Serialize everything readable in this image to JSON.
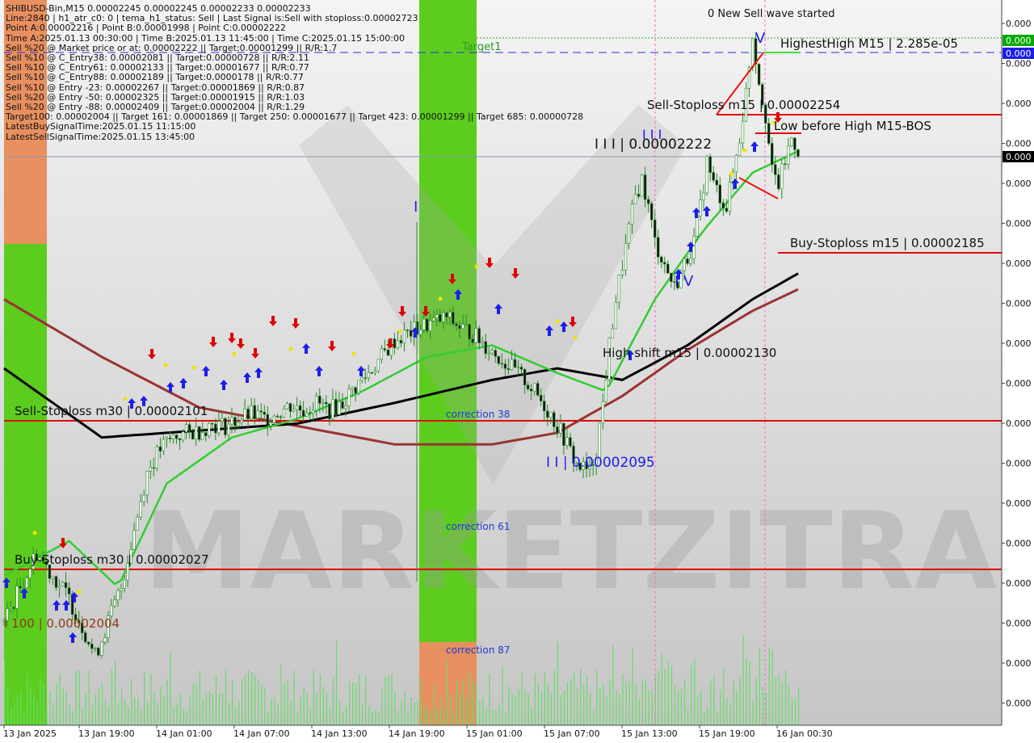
{
  "info_lines": [
    "SHIBUSD-Bin,M15  0.00002245 0.00002245 0.00002233 0.00002233",
    "Line:2840  |  h1_atr_c0: 0  |  tema_h1_status: Sell  |  Last Signal is:Sell with stoploss:0.00002723",
    "Point A:0.00002216  |  Point B:0.00001998  |  Point C:0.00002222",
    "Time A:2025.01.13 00:30:00  |  Time B:2025.01.13 11:45:00  |  Time C:2025.01.15 15:00:00",
    "Sell %20 @ Market price or at: 0.00002222  ||  Target:0.00001299  ||  R/R:1.7",
    "Sell %10 @ C_Entry38: 0.00002081  ||  Target:0.00000728  ||  R/R:2.11",
    "Sell %10 @ C_Entry61: 0.00002133  ||  Target:0.00001677  ||  R/R:0.77",
    "Sell %10 @ C_Entry88: 0.00002189  ||  Target:0.0000178  ||  R/R:0.77",
    "Sell %10 @ Entry -23: 0.00002267  ||  Target:0.00001869  ||  R/R:0.87",
    "Sell %20 @ Entry -50: 0.00002325  ||  Target:0.00001915  ||  R/R:1.03",
    "Sell %20 @ Entry -88: 0.00002409  ||  Target:0.00002004  ||  R/R:1.29",
    "Target100: 0.00002004  ||  Target 161: 0.00001869  ||  Target 250: 0.00001677  ||  Target 423: 0.00001299  ||  Target 685: 0.00000728",
    "LatestBuySignalTime:2025.01.15 11:15:00",
    "LatestSellSignalTime:2025.01.15 13:45:00"
  ],
  "watermark": "MARKETZITRADE",
  "colors": {
    "sell_line": "#e00000",
    "buy_line": "#e00000",
    "ema_green": "#33cc33",
    "ema_black": "#000000",
    "ema_brown": "#993333",
    "candle": "#2a8a2a",
    "volume": "#66dd66",
    "zone_green": "#5ccd1e",
    "zone_orange": "#e89060",
    "price_tag_green": "#00aa00",
    "price_tag_blue": "#1d1de8",
    "price_tag_black": "#000000",
    "wave_blue": "#1d1de8",
    "arrow_up": "#1d1de8",
    "arrow_down": "#e00000"
  },
  "annotations": {
    "new_wave": "0 New Sell wave started",
    "highest_high": "HighestHigh   M15 | 2.285e-05",
    "target1": "Target1",
    "sell_stoploss_m15": "Sell-Stoploss m15 | 0.00002254",
    "low_before_high": "Low before High   M15-BOS",
    "wave_III": "I I I | 0.00002222",
    "buy_stoploss_m15": "Buy-Stoploss m15 | 0.00002185",
    "wave_IV": "I V",
    "wave_V": "V",
    "wave_I": "I",
    "wave_II": "I I | 0.00002095",
    "wave_III_top": "I I I",
    "high_shift": "High shift m15 | 0.00002130",
    "sell_stoploss_m30": "Sell-Stoploss m30 | 0.00002101",
    "buy_stoploss_m30": "Buy-Stoploss m30 | 0.00002027",
    "target_100": "I 100 | 0.00002004",
    "correction_38": "correction 38",
    "correction_61": "correction 61",
    "correction_87": "correction 87"
  },
  "price_tags": [
    "0.000",
    "0.000",
    "0.000"
  ],
  "chart_data": {
    "type": "candlestick",
    "symbol": "SHIBUSD-Bin",
    "timeframe": "M15",
    "ohlc_last": {
      "open": 2.245e-05,
      "high": 2.245e-05,
      "low": 2.233e-05,
      "close": 2.233e-05
    },
    "y_tick_labels": [
      "0.000",
      "0.000",
      "0.000",
      "0.000",
      "0.000",
      "0.000",
      "0.000",
      "0.000",
      "0.000",
      "0.000",
      "0.000",
      "0.000",
      "0.000",
      "0.000",
      "0.000",
      "0.000",
      "0.000",
      "0.000"
    ],
    "x_tick_labels": [
      "13 Jan 2025",
      "13 Jan 19:00",
      "14 Jan 01:00",
      "14 Jan 07:00",
      "14 Jan 13:00",
      "14 Jan 19:00",
      "15 Jan 01:00",
      "15 Jan 07:00",
      "15 Jan 13:00",
      "15 Jan 19:00",
      "16 Jan 00:30"
    ],
    "ylim": [
      1.985e-05,
      2.3e-05
    ],
    "levels": {
      "highest_high": 2.285e-05,
      "sell_stoploss_m15": 2.254e-05,
      "buy_stoploss_m15": 2.185e-05,
      "high_shift_m15": 2.13e-05,
      "sell_stoploss_m30": 2.101e-05,
      "buy_stoploss_m30": 2.027e-05,
      "target_100": 2.004e-05
    },
    "close_path": [
      [
        0,
        2.03e-05
      ],
      [
        5,
        2.045e-05
      ],
      [
        10,
        2.06e-05
      ],
      [
        15,
        2.05e-05
      ],
      [
        20,
        2.04e-05
      ],
      [
        25,
        2.025e-05
      ],
      [
        28,
        2.015e-05
      ],
      [
        32,
        2.03e-05
      ],
      [
        36,
        2.045e-05
      ],
      [
        40,
        2.07e-05
      ],
      [
        44,
        2.095e-05
      ],
      [
        48,
        2.105e-05
      ],
      [
        52,
        2.11e-05
      ],
      [
        56,
        2.112e-05
      ],
      [
        60,
        2.113e-05
      ],
      [
        64,
        2.116e-05
      ],
      [
        68,
        2.115e-05
      ],
      [
        72,
        2.118e-05
      ],
      [
        76,
        2.12e-05
      ],
      [
        80,
        2.118e-05
      ],
      [
        84,
        2.121e-05
      ],
      [
        88,
        2.124e-05
      ],
      [
        92,
        2.122e-05
      ],
      [
        96,
        2.125e-05
      ],
      [
        100,
        2.122e-05
      ],
      [
        104,
        2.125e-05
      ],
      [
        108,
        2.132e-05
      ],
      [
        112,
        2.138e-05
      ],
      [
        116,
        2.145e-05
      ],
      [
        120,
        2.152e-05
      ],
      [
        124,
        2.155e-05
      ],
      [
        128,
        2.158e-05
      ],
      [
        132,
        2.16e-05
      ],
      [
        136,
        2.162e-05
      ],
      [
        140,
        2.158e-05
      ],
      [
        144,
        2.155e-05
      ],
      [
        148,
        2.15e-05
      ],
      [
        152,
        2.145e-05
      ],
      [
        156,
        2.14e-05
      ],
      [
        160,
        2.135e-05
      ],
      [
        164,
        2.128e-05
      ],
      [
        168,
        2.12e-05
      ],
      [
        172,
        2.11e-05
      ],
      [
        176,
        2.098e-05
      ],
      [
        180,
        2.095e-05
      ],
      [
        182,
        2.105e-05
      ],
      [
        184,
        2.125e-05
      ],
      [
        186,
        2.15e-05
      ],
      [
        188,
        2.17e-05
      ],
      [
        190,
        2.185e-05
      ],
      [
        192,
        2.2e-05
      ],
      [
        194,
        2.215e-05
      ],
      [
        196,
        2.222e-05
      ],
      [
        198,
        2.21e-05
      ],
      [
        200,
        2.195e-05
      ],
      [
        203,
        2.185e-05
      ],
      [
        206,
        2.175e-05
      ],
      [
        209,
        2.185e-05
      ],
      [
        212,
        2.195e-05
      ],
      [
        214,
        2.21e-05
      ],
      [
        216,
        2.23e-05
      ],
      [
        218,
        2.22e-05
      ],
      [
        220,
        2.215e-05
      ],
      [
        222,
        2.21e-05
      ],
      [
        224,
        2.225e-05
      ],
      [
        226,
        2.24e-05
      ],
      [
        228,
        2.26e-05
      ],
      [
        230,
        2.285e-05
      ],
      [
        232,
        2.265e-05
      ],
      [
        234,
        2.25e-05
      ],
      [
        236,
        2.225e-05
      ],
      [
        238,
        2.22e-05
      ],
      [
        240,
        2.23e-05
      ],
      [
        242,
        2.24e-05
      ],
      [
        244,
        2.235e-05
      ]
    ],
    "ema_green": [
      [
        0,
        2.05e-05
      ],
      [
        20,
        2.065e-05
      ],
      [
        35,
        2.045e-05
      ],
      [
        50,
        2.09e-05
      ],
      [
        70,
        2.11e-05
      ],
      [
        90,
        2.118e-05
      ],
      [
        110,
        2.13e-05
      ],
      [
        130,
        2.145e-05
      ],
      [
        150,
        2.15e-05
      ],
      [
        170,
        2.138e-05
      ],
      [
        185,
        2.13e-05
      ],
      [
        200,
        2.17e-05
      ],
      [
        215,
        2.2e-05
      ],
      [
        230,
        2.225e-05
      ],
      [
        245,
        2.235e-05
      ]
    ],
    "ema_black": [
      [
        0,
        2.14e-05
      ],
      [
        30,
        2.11e-05
      ],
      [
        60,
        2.113e-05
      ],
      [
        90,
        2.116e-05
      ],
      [
        120,
        2.125e-05
      ],
      [
        150,
        2.135e-05
      ],
      [
        170,
        2.14e-05
      ],
      [
        190,
        2.135e-05
      ],
      [
        210,
        2.15e-05
      ],
      [
        230,
        2.17e-05
      ],
      [
        245,
        2.182e-05
      ]
    ],
    "ema_brown": [
      [
        0,
        2.17e-05
      ],
      [
        30,
        2.145e-05
      ],
      [
        60,
        2.123e-05
      ],
      [
        90,
        2.115e-05
      ],
      [
        120,
        2.107e-05
      ],
      [
        150,
        2.107e-05
      ],
      [
        170,
        2.112e-05
      ],
      [
        190,
        2.128e-05
      ],
      [
        210,
        2.148e-05
      ],
      [
        230,
        2.165e-05
      ],
      [
        245,
        2.175e-05
      ]
    ],
    "bars": 245
  }
}
